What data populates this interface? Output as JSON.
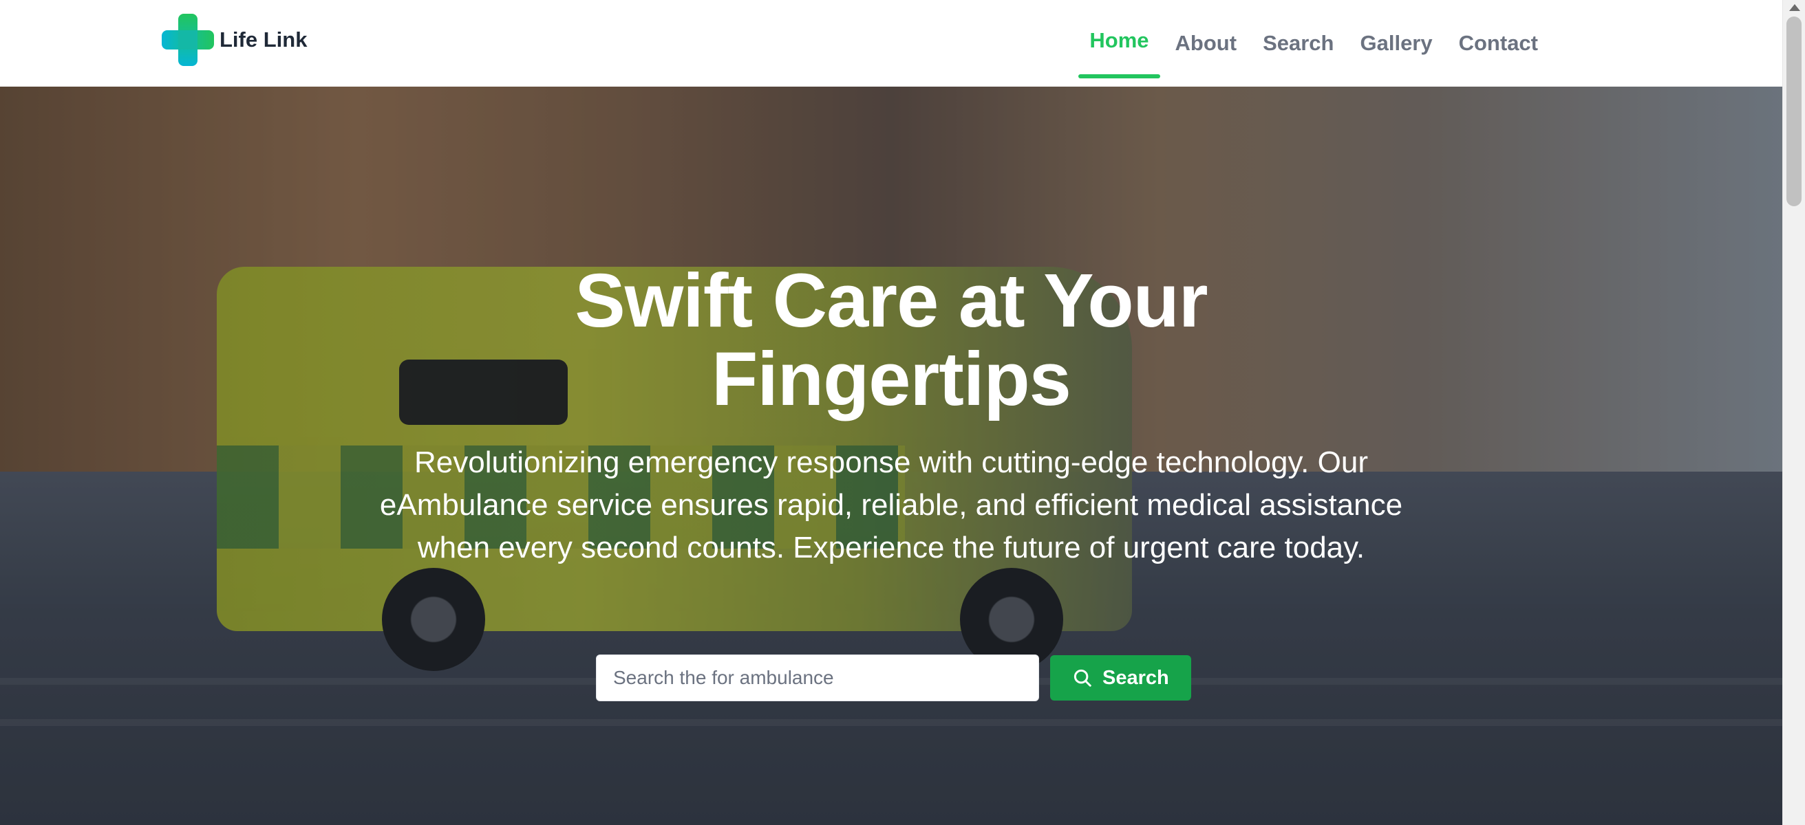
{
  "brand": {
    "name": "Life Link",
    "logo_icon": "medical-cross-icon"
  },
  "nav": {
    "items": [
      {
        "label": "Home",
        "active": true
      },
      {
        "label": "About",
        "active": false
      },
      {
        "label": "Search",
        "active": false
      },
      {
        "label": "Gallery",
        "active": false
      },
      {
        "label": "Contact",
        "active": false
      }
    ]
  },
  "hero": {
    "title_line1": "Swift Care at Your",
    "title_line2": "Fingertips",
    "subtitle": "Revolutionizing emergency response with cutting-edge technology. Our eAmbulance service ensures rapid, reliable, and efficient medical assistance when every second counts. Experience the future of urgent care today."
  },
  "search": {
    "placeholder": "Search the for ambulance",
    "value": "",
    "button_label": "Search",
    "button_icon": "search-icon"
  },
  "colors": {
    "accent": "#22c55e",
    "button": "#16a34a",
    "nav_text": "#6b7280"
  }
}
